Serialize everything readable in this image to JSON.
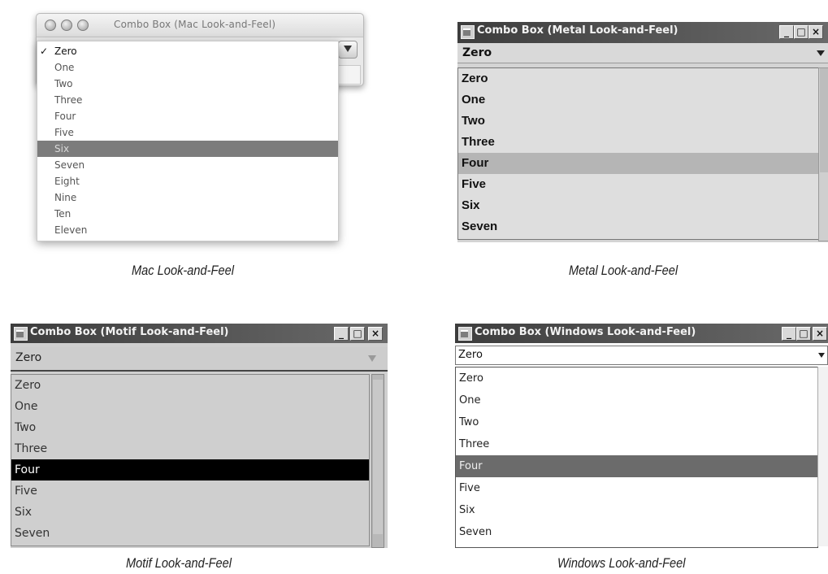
{
  "mac": {
    "title": "Combo Box (Mac Look-and-Feel)",
    "items": [
      "Zero",
      "One",
      "Two",
      "Three",
      "Four",
      "Five",
      "Six",
      "Seven",
      "Eight",
      "Nine",
      "Ten",
      "Eleven"
    ],
    "checked_index": 0,
    "selected_index": 6,
    "checkmark": "✓",
    "caption": "Mac Look-and-Feel"
  },
  "metal": {
    "title": "Combo Box (Metal Look-and-Feel)",
    "current_value": "Zero",
    "items": [
      "Zero",
      "One",
      "Two",
      "Three",
      "Four",
      "Five",
      "Six",
      "Seven"
    ],
    "selected_index": 4,
    "caption": "Metal Look-and-Feel"
  },
  "motif": {
    "title": "Combo Box (Motif Look-and-Feel)",
    "current_value": "Zero",
    "items": [
      "Zero",
      "One",
      "Two",
      "Three",
      "Four",
      "Five",
      "Six",
      "Seven"
    ],
    "selected_index": 4,
    "caption": "Motif Look-and-Feel"
  },
  "windows": {
    "title": "Combo Box (Windows Look-and-Feel)",
    "current_value": "Zero",
    "items": [
      "Zero",
      "One",
      "Two",
      "Three",
      "Four",
      "Five",
      "Six",
      "Seven"
    ],
    "selected_index": 4,
    "caption": "Windows Look-and-Feel"
  }
}
